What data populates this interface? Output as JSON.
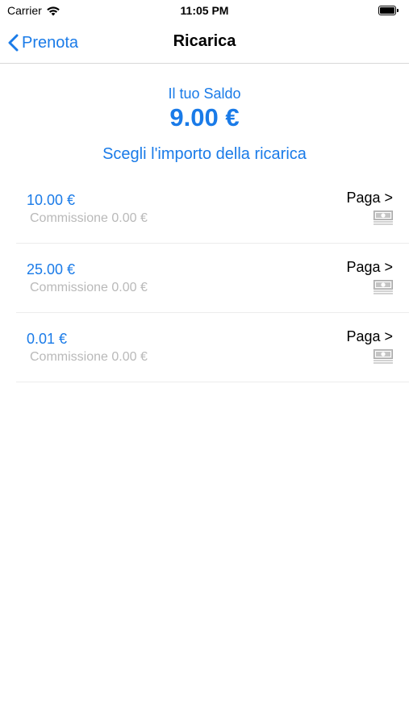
{
  "status_bar": {
    "carrier": "Carrier",
    "time": "11:05 PM",
    "icons": [
      "wifi-icon",
      "battery-icon"
    ]
  },
  "nav": {
    "back_label": "Prenota",
    "title": "Ricarica"
  },
  "balance": {
    "label": "Il tuo Saldo",
    "value": "9.00 €"
  },
  "choose_label": "Scegli l'importo della ricarica",
  "options": [
    {
      "amount": "10.00 €",
      "commission": "Commissione 0.00 €",
      "pay_label": "Paga >",
      "icon": "cash-icon"
    },
    {
      "amount": "25.00 €",
      "commission": "Commissione 0.00 €",
      "pay_label": "Paga >",
      "icon": "cash-icon"
    },
    {
      "amount": "0.01 €",
      "commission": "Commissione 0.00 €",
      "pay_label": "Paga >",
      "icon": "cash-icon"
    }
  ],
  "colors": {
    "accent": "#1a7be8",
    "muted_text": "#b9b9b9",
    "separator": "#ececec"
  }
}
